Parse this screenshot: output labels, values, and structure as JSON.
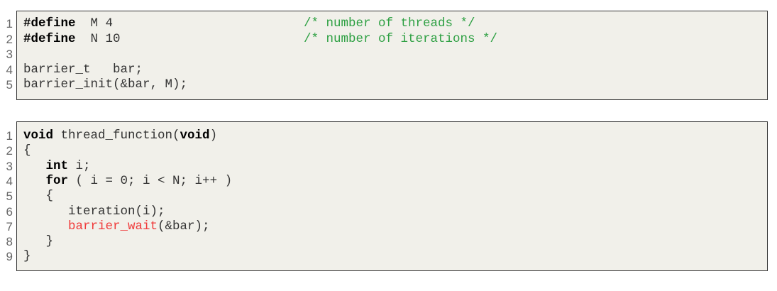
{
  "listing1": {
    "lines": [
      {
        "num": "1",
        "kw": "#define",
        "rest": "  M 4",
        "comment": "/* number of threads */"
      },
      {
        "num": "2",
        "kw": "#define",
        "rest": "  N 10",
        "comment": "/* number of iterations */"
      },
      {
        "num": "3",
        "rest": ""
      },
      {
        "num": "4",
        "rest": "barrier_t   bar;"
      },
      {
        "num": "5",
        "rest": "barrier_init(&bar, M);"
      }
    ]
  },
  "listing2": {
    "lines": [
      {
        "num": "1",
        "kw": "void",
        "rest": " thread_function(",
        "kw2": "void",
        "rest2": ")"
      },
      {
        "num": "2",
        "rest": "{"
      },
      {
        "num": "3",
        "indent": "   ",
        "kw": "int",
        "rest": " i;"
      },
      {
        "num": "4",
        "indent": "   ",
        "kw": "for",
        "rest": " ( i = 0; i < N; i++ )"
      },
      {
        "num": "5",
        "indent": "   ",
        "rest": "{"
      },
      {
        "num": "6",
        "indent": "      ",
        "rest": "iteration(i);"
      },
      {
        "num": "7",
        "indent": "      ",
        "red": "barrier_wait",
        "rest": "(&bar);"
      },
      {
        "num": "8",
        "indent": "   ",
        "rest": "}"
      },
      {
        "num": "9",
        "rest": "}"
      }
    ]
  }
}
